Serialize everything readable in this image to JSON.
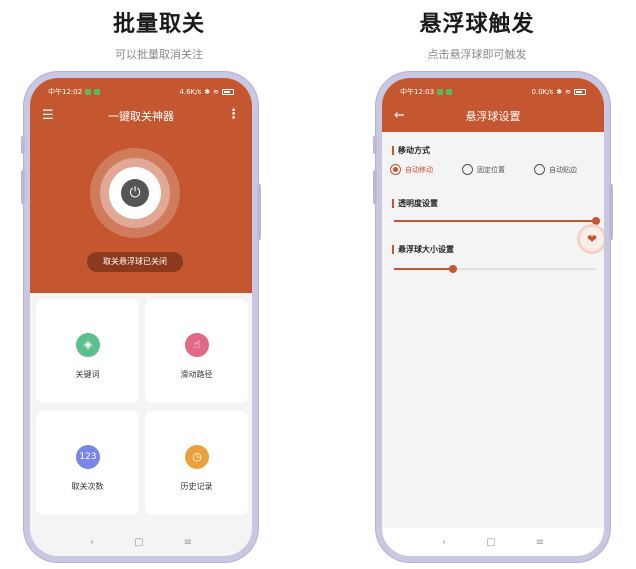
{
  "left_panel": {
    "title": "批量取关",
    "subtitle": "可以批量取消关注",
    "status": {
      "time": "中午12:02",
      "speed": "4.6K/s"
    },
    "appbar": {
      "title": "一键取关神器",
      "menu_icon": "menu-icon",
      "more_icon": "more-vert-icon"
    },
    "toggle_label": "取关悬浮球已关闭",
    "cards": [
      {
        "label": "关键词",
        "icon": "keyword-icon",
        "color": "#5bbf8e"
      },
      {
        "label": "滑动路径",
        "icon": "swipe-icon",
        "color": "#e06a86"
      },
      {
        "label": "取关次数",
        "icon": "counter-icon",
        "color": "#7b86e6"
      },
      {
        "label": "历史记录",
        "icon": "clock-icon",
        "color": "#e9a23b"
      }
    ]
  },
  "right_panel": {
    "title": "悬浮球触发",
    "subtitle": "点击悬浮球即可触发",
    "status": {
      "time": "中午12:03",
      "speed": "0.0K/s"
    },
    "appbar": {
      "title": "悬浮球设置",
      "back_icon": "back-arrow-icon"
    },
    "move_section": {
      "label": "移动方式",
      "options": [
        {
          "label": "自动移动",
          "selected": true
        },
        {
          "label": "固定位置",
          "selected": false
        },
        {
          "label": "自动贴边",
          "selected": false
        }
      ]
    },
    "opacity_section": {
      "label": "透明度设置",
      "value_percent": 100
    },
    "size_section": {
      "label": "悬浮球大小设置",
      "value_percent": 29
    },
    "float_ball_icon": "heart-icon"
  },
  "colors": {
    "accent": "#c45630",
    "phone_frame": "#c9c8e2"
  }
}
